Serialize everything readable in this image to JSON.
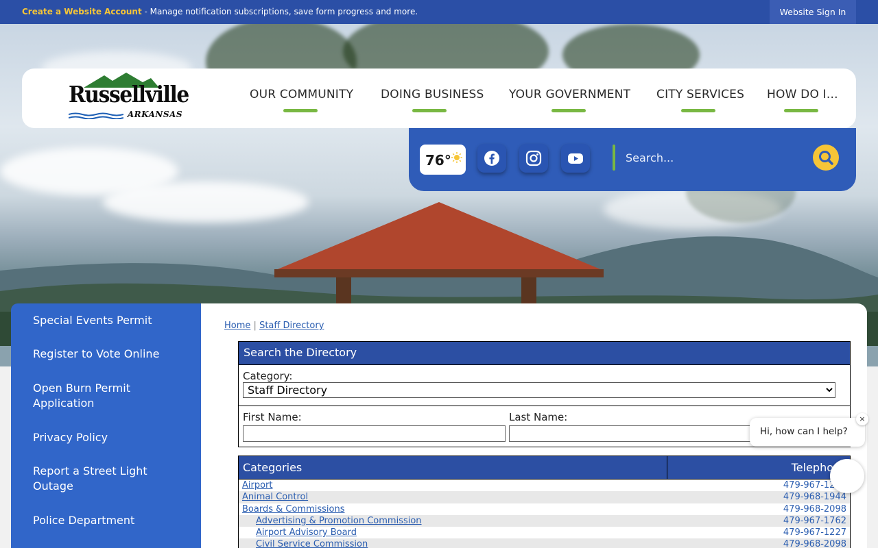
{
  "topbar": {
    "create_account_label": "Create a Website Account",
    "message": " - Manage notification subscriptions, save form progress and more.",
    "signin_label": "Website Sign In"
  },
  "logo": {
    "name": "Russellville",
    "state": "ARKANSAS"
  },
  "nav": {
    "items": [
      {
        "label": "OUR COMMUNITY"
      },
      {
        "label": "DOING BUSINESS"
      },
      {
        "label": "YOUR GOVERNMENT"
      },
      {
        "label": "CITY SERVICES"
      },
      {
        "label": "HOW DO I..."
      }
    ]
  },
  "utility": {
    "weather_temp": "76°",
    "search_placeholder": "Search...",
    "social": [
      "facebook-icon",
      "instagram-icon",
      "youtube-icon"
    ]
  },
  "sidebar": {
    "items": [
      {
        "label": "Special Events Permit"
      },
      {
        "label": "Register to Vote Online"
      },
      {
        "label": "Open Burn Permit Application"
      },
      {
        "label": "Privacy Policy"
      },
      {
        "label": "Report a Street Light Outage"
      },
      {
        "label": "Police Department"
      }
    ]
  },
  "breadcrumb": {
    "home": "Home",
    "separator": "|",
    "current": "Staff Directory"
  },
  "directory": {
    "title": "Search the Directory",
    "category_label": "Category:",
    "category_value": "Staff Directory",
    "first_name_label": "First Name:",
    "last_name_label": "Last Name:"
  },
  "categories": {
    "header_name": "Categories",
    "header_tel": "Telephone",
    "rows": [
      {
        "name": "Airport",
        "tel": "479-967-1227",
        "indent": 0
      },
      {
        "name": "Animal Control",
        "tel": "479-968-1944",
        "indent": 0
      },
      {
        "name": "Boards & Commissions",
        "tel": "479-968-2098",
        "indent": 0
      },
      {
        "name": "Advertising & Promotion Commission",
        "tel": "479-967-1762",
        "indent": 1
      },
      {
        "name": "Airport Advisory Board",
        "tel": "479-967-1227",
        "indent": 1
      },
      {
        "name": "Civil Service Commission",
        "tel": "479-968-2098",
        "indent": 1
      }
    ]
  },
  "chat": {
    "prompt": "Hi, how can I help?",
    "close": "×"
  },
  "colors": {
    "brand_blue": "#2b4fa6",
    "accent_green": "#79b843",
    "accent_yellow": "#f6c537"
  }
}
